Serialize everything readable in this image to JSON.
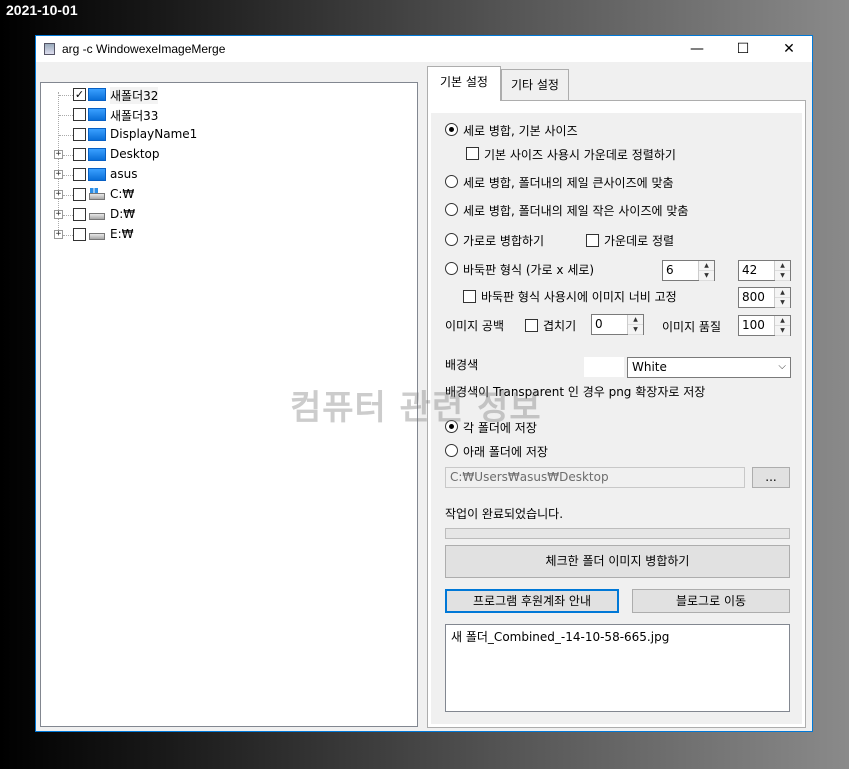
{
  "date_label": "2021-10-01",
  "window": {
    "title": "arg -c  WindowexeImageMerge",
    "minimize_glyph": "—",
    "maximize_glyph": "☐",
    "close_glyph": "✕"
  },
  "tree": {
    "items": [
      {
        "label": "새폴더32",
        "checked": true,
        "icon": "folder-icon"
      },
      {
        "label": "새폴더33",
        "checked": false,
        "icon": "folder-icon"
      },
      {
        "label": "DisplayName1",
        "checked": false,
        "icon": "folder-icon"
      },
      {
        "label": "Desktop",
        "checked": false,
        "icon": "folder-icon",
        "expander": "+"
      },
      {
        "label": "asus",
        "checked": false,
        "icon": "folder-icon",
        "expander": "+"
      },
      {
        "label": "C:₩",
        "checked": false,
        "icon": "windows-drive-icon",
        "expander": "+"
      },
      {
        "label": "D:₩",
        "checked": false,
        "icon": "drive-icon",
        "expander": "+"
      },
      {
        "label": "E:₩",
        "checked": false,
        "icon": "drive-icon",
        "expander": "+"
      }
    ],
    "check_glyph": "✓"
  },
  "tabs": {
    "basic": "기본 설정",
    "other": "기타 설정"
  },
  "options": {
    "vertical_basic": "세로 병합, 기본 사이즈",
    "center_align": "기본 사이즈 사용시 가운데로 정렬하기",
    "vertical_largest": "세로 병합, 폴더내의 제일 큰사이즈에 맞춤",
    "vertical_smallest": "세로 병합, 폴더내의 제일 작은 사이즈에 맞춤",
    "horizontal": "가로로 병합하기",
    "horizontal_center": "가운데로 정렬",
    "grid": "바둑판 형식 (가로 x 세로)",
    "grid_cols": "6",
    "grid_rows": "42",
    "grid_fixed_width": "바둑판 형식 사용시에 이미지 너비 고정",
    "grid_width": "800",
    "spacing_label": "이미지 공백",
    "overlap_label": "겹치기",
    "spacing_value": "0",
    "quality_label": "이미지 품질",
    "quality_value": "100",
    "bg_label": "배경색",
    "bg_value": "White",
    "bg_note": "배경색이 Transparent 인 경우 png 확장자로 저장",
    "save_each": "각 폴더에 저장",
    "save_below": "아래 폴더에 저장",
    "save_path": "C:₩Users₩asus₩Desktop",
    "browse": "...",
    "status": "작업이 완료되었습니다.",
    "merge_button": "체크한 폴더 이미지 병합하기",
    "donate_button": "프로그램 후원계좌 안내",
    "blog_button": "블로그로 이동",
    "result_file": "새 폴더_Combined_-14-10-58-665.jpg"
  },
  "selected": {
    "merge_mode": "vertical_basic",
    "save_mode": "save_each"
  },
  "watermark": "컴퓨터 관련 정보"
}
